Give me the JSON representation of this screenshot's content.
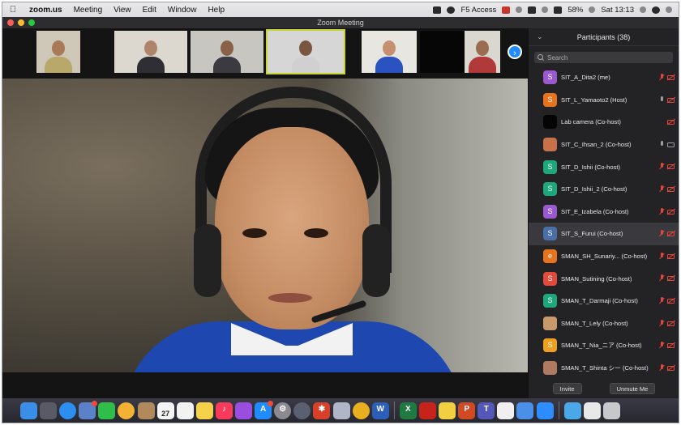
{
  "menubar": {
    "app_name": "zoom.us",
    "menus": [
      "Meeting",
      "View",
      "Edit",
      "Window",
      "Help"
    ],
    "f5_access": "F5 Access",
    "battery": "58%",
    "clock": "Sat 13:13"
  },
  "window": {
    "title": "Zoom Meeting",
    "lights": {
      "close": "#ff5f57",
      "minimize": "#febc2e",
      "zoom": "#28c840"
    }
  },
  "gallery": {
    "next_icon": "chevron-right-icon",
    "thumbs": [
      {
        "name": "participant-thumb-1",
        "bg": "#cfc8b8",
        "torso": "#b8a86a",
        "head": "#a87a56"
      },
      {
        "name": "participant-thumb-2",
        "bg": "#dcd8d0",
        "torso": "#2e2e34",
        "head": "#b0846a"
      },
      {
        "name": "participant-thumb-3",
        "bg": "#c8c6c0",
        "torso": "#3a3a40",
        "head": "#8a6248"
      },
      {
        "name": "participant-thumb-4",
        "bg": "#d6d6d6",
        "torso": "#d0d0d0",
        "head": "#7a5640"
      },
      {
        "name": "participant-thumb-5",
        "bg": "#e8e6e0",
        "torso": "#2a52c0",
        "head": "#c49070"
      },
      {
        "name": "participant-thumb-6",
        "bg": "#060606",
        "torso": "#060606",
        "head": "#060606"
      },
      {
        "name": "participant-thumb-7",
        "bg": "#dad7d0",
        "torso": "#b03a3a",
        "head": "#9a6c52"
      }
    ]
  },
  "participants": {
    "header": "Participants (38)",
    "search_placeholder": "Search",
    "list": [
      {
        "name": "SIT_A_Dita2 (me)",
        "initial": "S",
        "color": "#9b59d0",
        "mic": "muted",
        "cam": "off"
      },
      {
        "name": "SIT_L_Yamaoto2 (Host)",
        "initial": "S",
        "color": "#e8731f",
        "mic": "on",
        "cam": "off"
      },
      {
        "name": "Lab camera (Co-host)",
        "initial": "",
        "color": "#050505",
        "mic": "none",
        "cam": "off"
      },
      {
        "name": "SIT_C_Ihsan_2 (Co-host)",
        "initial": "",
        "color": "#c8704a",
        "mic": "on",
        "cam": "on"
      },
      {
        "name": "SIT_D_Ishii (Co-host)",
        "initial": "S",
        "color": "#1da77a",
        "mic": "muted",
        "cam": "off"
      },
      {
        "name": "SIT_D_Ishii_2 (Co-host)",
        "initial": "S",
        "color": "#1da77a",
        "mic": "muted",
        "cam": "off"
      },
      {
        "name": "SIT_E_Izabela (Co-host)",
        "initial": "S",
        "color": "#9b59d0",
        "mic": "muted",
        "cam": "off"
      },
      {
        "name": "SIT_S_Furui (Co-host)",
        "initial": "S",
        "color": "#4a6ea8",
        "mic": "muted",
        "cam": "off"
      },
      {
        "name": "SMAN_SH_Sunariy... (Co-host)",
        "initial": "e",
        "color": "#e8731f",
        "mic": "muted",
        "cam": "off"
      },
      {
        "name": "SMAN_Sutining (Co-host)",
        "initial": "S",
        "color": "#e24a3c",
        "mic": "muted",
        "cam": "off"
      },
      {
        "name": "SMAN_T_Darmaji (Co-host)",
        "initial": "S",
        "color": "#1da77a",
        "mic": "muted",
        "cam": "off"
      },
      {
        "name": "SMAN_T_Lely (Co-host)",
        "initial": "",
        "color": "#c89a6a",
        "mic": "muted",
        "cam": "off"
      },
      {
        "name": "SMAN_T_Nia_ニア (Co-host)",
        "initial": "S",
        "color": "#f0a020",
        "mic": "muted",
        "cam": "off"
      },
      {
        "name": "SMAN_T_Shinta シー (Co-host)",
        "initial": "",
        "color": "#b07a60",
        "mic": "muted",
        "cam": "off"
      }
    ],
    "selected_index": 7,
    "invite_label": "Invite",
    "unmute_label": "Unmute Me"
  },
  "dock": {
    "apps": [
      {
        "name": "finder-icon",
        "color": "#3a8ee8",
        "glyph": ""
      },
      {
        "name": "launchpad-icon",
        "color": "#5a5a66",
        "glyph": ""
      },
      {
        "name": "safari-icon",
        "color": "#2b8ef0",
        "glyph": "",
        "round": true
      },
      {
        "name": "preview-icon",
        "color": "#5b82c8",
        "glyph": "",
        "badge": true
      },
      {
        "name": "facetime-icon",
        "color": "#2fbe4a",
        "glyph": ""
      },
      {
        "name": "photos-icon",
        "color": "#f3b234",
        "glyph": "",
        "round": true
      },
      {
        "name": "contacts-icon",
        "color": "#b08a5a",
        "glyph": ""
      },
      {
        "name": "calendar-icon",
        "color": "#f4f4f4",
        "glyph": "",
        "sub": "27"
      },
      {
        "name": "reminders-icon",
        "color": "#f2f2f2",
        "glyph": ""
      },
      {
        "name": "notes-icon",
        "color": "#f6d24a",
        "glyph": ""
      },
      {
        "name": "music-icon",
        "color": "#fa3a5a",
        "glyph": "♪"
      },
      {
        "name": "podcasts-icon",
        "color": "#9a4ee0",
        "glyph": ""
      },
      {
        "name": "app-store-icon",
        "color": "#1f8bff",
        "glyph": "A",
        "badge": true
      },
      {
        "name": "system-preferences-icon",
        "color": "#8a8a90",
        "glyph": "⚙",
        "round": true
      },
      {
        "name": "time-machine-icon",
        "color": "#5a6070",
        "glyph": "",
        "round": true
      },
      {
        "name": "settings-gear-icon",
        "color": "#d8402a",
        "glyph": "✱"
      },
      {
        "name": "utility-icon",
        "color": "#b0b6c8",
        "glyph": ""
      },
      {
        "name": "chrome-icon",
        "color": "#e8b020",
        "glyph": "",
        "round": true
      },
      {
        "name": "word-icon",
        "color": "#2b5fb8",
        "glyph": "W"
      },
      {
        "name": "excel-icon",
        "color": "#1f7a42",
        "glyph": "X"
      },
      {
        "name": "acrobat-icon",
        "color": "#c8231a",
        "glyph": ""
      },
      {
        "name": "stickies-icon",
        "color": "#f0d040",
        "glyph": ""
      },
      {
        "name": "powerpoint-icon",
        "color": "#d04a24",
        "glyph": "P"
      },
      {
        "name": "teams-icon",
        "color": "#5458b8",
        "glyph": "T"
      },
      {
        "name": "textedit-icon",
        "color": "#f0f0f0",
        "glyph": ""
      },
      {
        "name": "mail-icon",
        "color": "#4a90e8",
        "glyph": ""
      },
      {
        "name": "zoom-icon",
        "color": "#2d8cff",
        "glyph": ""
      },
      {
        "name": "folder-icon",
        "color": "#4aa8e8",
        "glyph": ""
      },
      {
        "name": "downloads-icon",
        "color": "#e8e8e8",
        "glyph": ""
      },
      {
        "name": "trash-icon",
        "color": "#c8c8cc",
        "glyph": ""
      }
    ]
  }
}
